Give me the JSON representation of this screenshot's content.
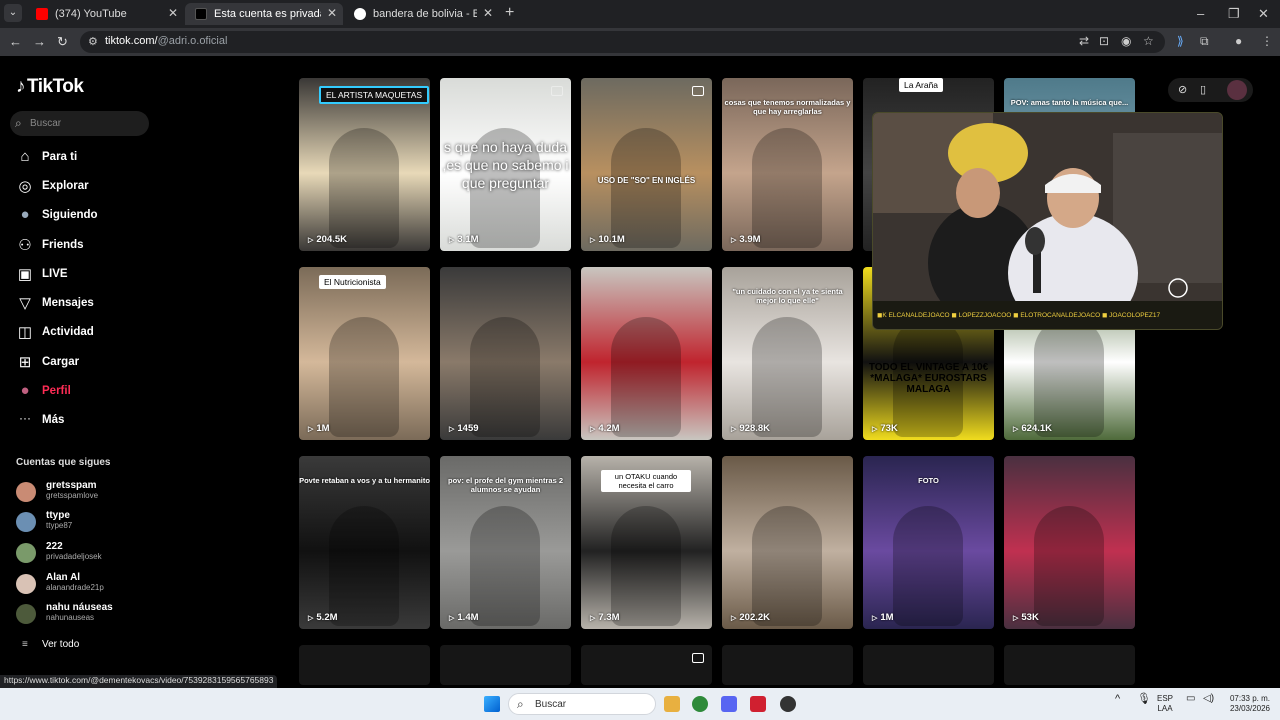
{
  "browser": {
    "tabs": [
      {
        "title": "(374) YouTube",
        "favicon_color": "#ff0000",
        "active": false
      },
      {
        "title": "Esta cuenta es privada. Sigue e",
        "favicon_color": "#000000",
        "active": true
      },
      {
        "title": "bandera de bolivia - Buscar con",
        "favicon_color": "#4285f4",
        "active": false
      }
    ],
    "url_host": "tiktok.com/",
    "url_path": "@adri.o.oficial"
  },
  "sidebar": {
    "logo": "TikTok",
    "search_placeholder": "Buscar",
    "nav": [
      {
        "label": "Para ti",
        "icon": "home-icon",
        "glyph": "⌂"
      },
      {
        "label": "Explorar",
        "icon": "compass-icon",
        "glyph": "◎"
      },
      {
        "label": "Siguiendo",
        "icon": "following-avatar-icon",
        "glyph": "●"
      },
      {
        "label": "Friends",
        "icon": "friends-icon",
        "glyph": "⚇"
      },
      {
        "label": "LIVE",
        "icon": "live-icon",
        "glyph": "▣"
      },
      {
        "label": "Mensajes",
        "icon": "messages-icon",
        "glyph": "▽"
      },
      {
        "label": "Actividad",
        "icon": "activity-icon",
        "glyph": "◫"
      },
      {
        "label": "Cargar",
        "icon": "upload-icon",
        "glyph": "⊞"
      },
      {
        "label": "Perfil",
        "icon": "profile-avatar-icon",
        "glyph": "●"
      },
      {
        "label": "Más",
        "icon": "more-icon",
        "glyph": "···"
      }
    ],
    "following_title": "Cuentas que sigues",
    "following": [
      {
        "name": "gretsspam",
        "handle": "gretsspamlove",
        "color": "#c98b74"
      },
      {
        "name": "ttype",
        "handle": "ttype87",
        "color": "#6b8fb3"
      },
      {
        "name": "222",
        "handle": "privadadeljosek",
        "color": "#7a9a6a"
      },
      {
        "name": "Alan Al",
        "handle": "alanandrade21p",
        "color": "#d9c2b5"
      },
      {
        "name": "nahu náuseas",
        "handle": "nahunauseas",
        "color": "#4d5a3b"
      }
    ],
    "see_all": "Ver todo"
  },
  "videos": [
    {
      "views": "204.5K",
      "caption": "EL ARTISTA MAQUETAS",
      "bg": "#3a3836",
      "accent": "#e8d9b8"
    },
    {
      "views": "3.1M",
      "caption": "s que no haya duda ,es que no sabemo i que preguntar",
      "bg": "#d9dbd8",
      "accent": "#ffffff"
    },
    {
      "views": "10.1M",
      "caption": "USO DE \"SO\" EN INGLÉS",
      "bg": "#6d6a60",
      "accent": "#b89060"
    },
    {
      "views": "3.9M",
      "caption": "cosas que tenemos normalizadas y que hay arreglarlas",
      "bg": "#7a675a",
      "accent": "#c4a48c"
    },
    {
      "views": "",
      "caption": "La Araña",
      "bg": "#222222",
      "accent": "#444444"
    },
    {
      "views": "",
      "caption": "POV: amas tanto la música que...",
      "bg": "#4f7a8a",
      "accent": "#7aa3b3"
    },
    {
      "views": "1M",
      "caption": "El Nutricionista",
      "bg": "#7b6b58",
      "accent": "#d4b89a"
    },
    {
      "views": "1459",
      "caption": "",
      "bg": "#3a3a3a",
      "accent": "#8a7a6a"
    },
    {
      "views": "4.2M",
      "caption": "",
      "bg": "#c8c6c0",
      "accent": "#c0242e"
    },
    {
      "views": "928.8K",
      "caption": "\"un cuidado con el ya te sienta mejor lo que elle\"",
      "bg": "#a8a29a",
      "accent": "#e8e4e0"
    },
    {
      "views": "73K",
      "caption": "TODO EL VINTAGE A 10€ *MALAGA* EUROSTARS MALAGA",
      "bg": "#f0dc1e",
      "accent": "#111111"
    },
    {
      "views": "624.1K",
      "caption": "",
      "bg": "#4e6a3a",
      "accent": "#ffffff"
    },
    {
      "views": "5.2M",
      "caption": "Povte retaban a vos y a tu hermanito",
      "bg": "#3a3a3a",
      "accent": "#111111"
    },
    {
      "views": "1.4M",
      "caption": "pov: el profe del gym mientras 2 alumnos se ayudan",
      "bg": "#6a6a68",
      "accent": "#9a9a98"
    },
    {
      "views": "7.3M",
      "caption": "un OTAKU cuando necesita el carro",
      "bg": "#b7b2aa",
      "accent": "#222222"
    },
    {
      "views": "202.2K",
      "caption": "",
      "bg": "#6a5a48",
      "accent": "#c0b0a0"
    },
    {
      "views": "1M",
      "caption": "FOTO",
      "bg": "#2a2550",
      "accent": "#6a4aa0"
    },
    {
      "views": "53K",
      "caption": "",
      "bg": "#4a3040",
      "accent": "#c03050"
    }
  ],
  "pip": {
    "tags": "◼K ELCANALDEJOACO   ◼ LOPEZZJOACOO   ◼ ELOTROCANALDEJOACO   ◼ JOACOLOPEZ17"
  },
  "status_url": "https://www.tiktok.com/@dementekovacs/video/7539283159565765893",
  "taskbar": {
    "search": "Buscar",
    "lang_top": "ESP",
    "lang_bottom": "LAA",
    "time": "07:33 p. m.",
    "date": "23/03/2026"
  },
  "colors": {
    "accent": "#fe2c55",
    "bg": "#000000"
  }
}
